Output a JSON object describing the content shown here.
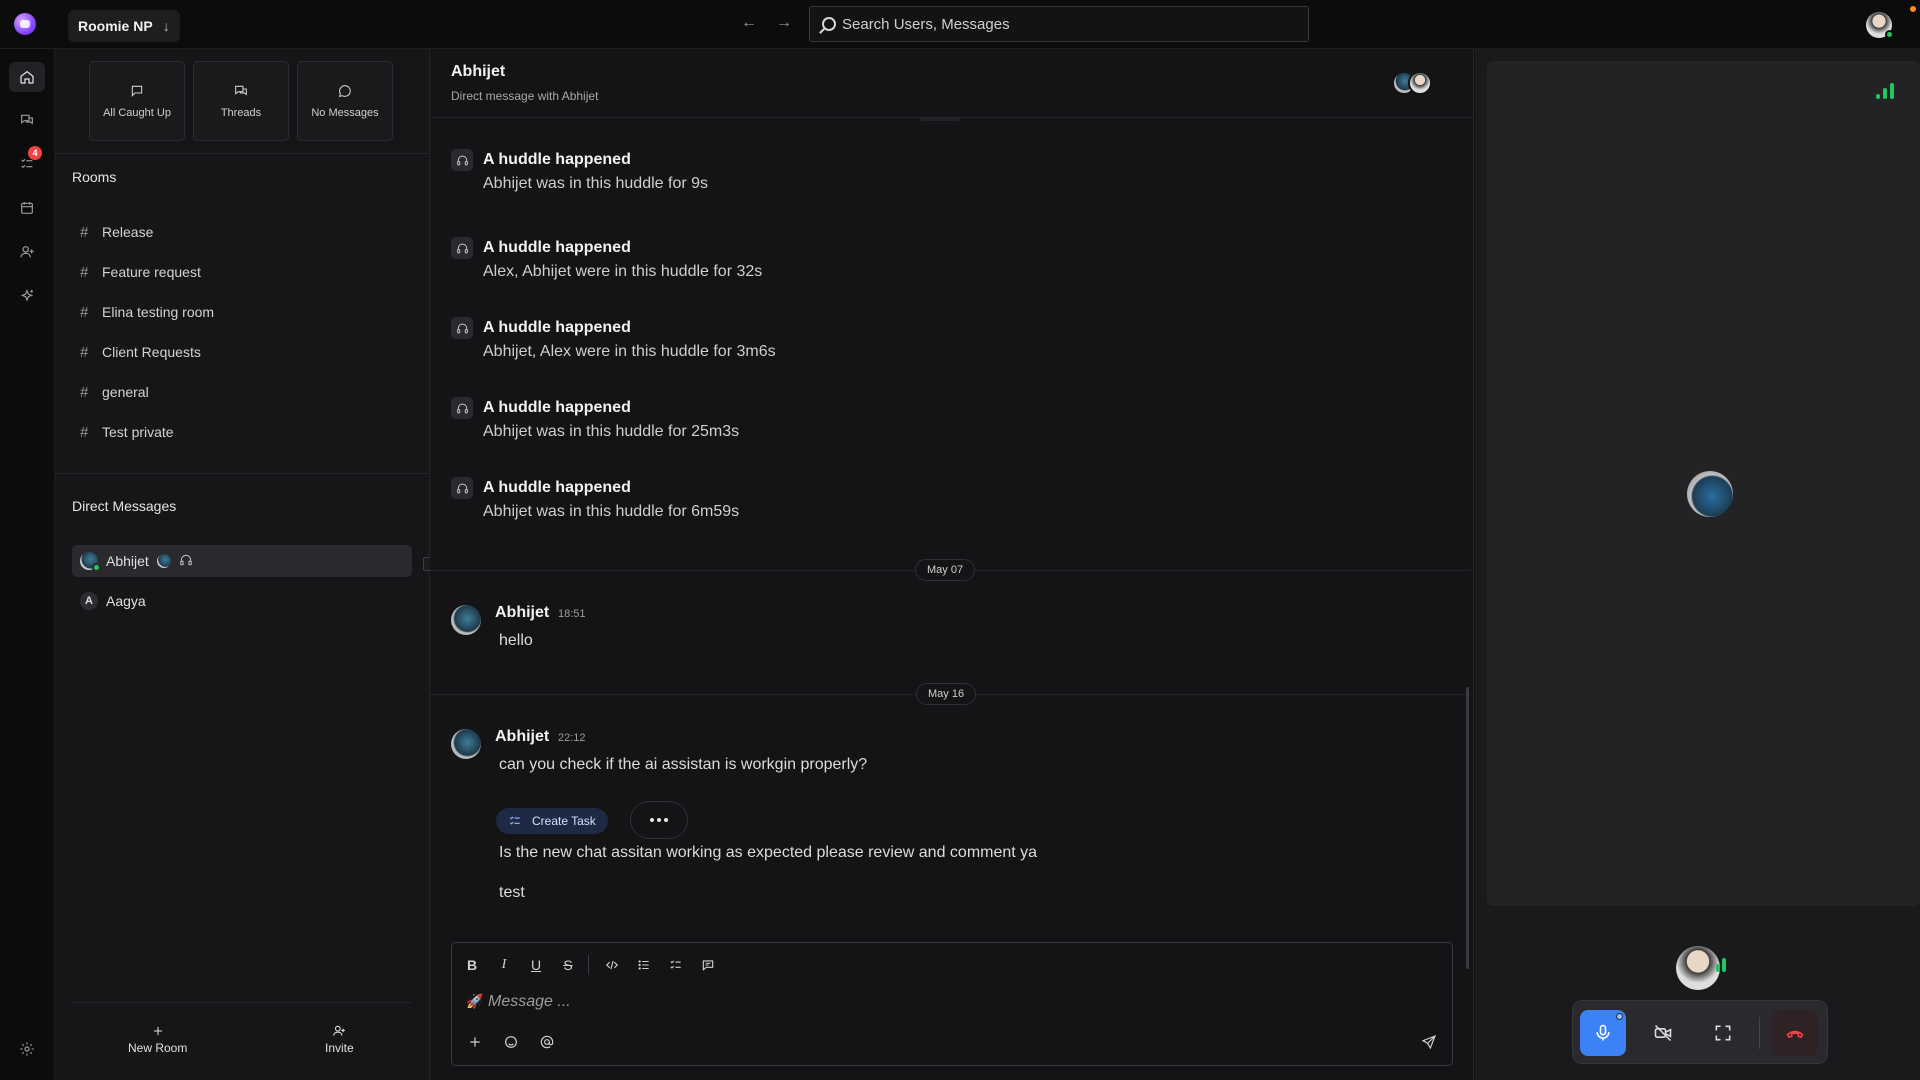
{
  "topbar": {
    "workspace_name": "Roomie NP",
    "workspace_arrow": "↓",
    "back_arrow": "←",
    "forward_arrow": "→",
    "search_placeholder": "Search Users, Messages"
  },
  "rail": {
    "items": [
      "home-icon",
      "chat-icon",
      "tasks-icon",
      "calendar-icon",
      "user-add-icon",
      "sparkles-icon",
      "settings-icon"
    ],
    "tasks_badge": "4"
  },
  "sidebar": {
    "quick": [
      {
        "label": "All Caught Up",
        "icon": "chat-bubble-icon"
      },
      {
        "label": "Threads",
        "icon": "threads-icon"
      },
      {
        "label": "No Messages",
        "icon": "message-circle-icon"
      }
    ],
    "rooms_title": "Rooms",
    "rooms": [
      "Release",
      "Feature request",
      "Elina testing room",
      "Client Requests",
      "general",
      "Test private"
    ],
    "dm_title": "Direct Messages",
    "dms": [
      {
        "name": "Abhijet",
        "avatar": "image",
        "active": true
      },
      {
        "name": "Aagya",
        "avatar_letter": "A",
        "active": false
      }
    ],
    "new_room_label": "New Room",
    "invite_label": "Invite"
  },
  "chat": {
    "title": "Abhijet",
    "subtitle": "Direct message with Abhijet",
    "huddles": [
      {
        "title": "A huddle happened",
        "detail": "Abhijet was in this huddle for 9s"
      },
      {
        "title": "A huddle happened",
        "detail": "Alex, Abhijet were in this huddle for 32s"
      },
      {
        "title": "A huddle happened",
        "detail": "Abhijet, Alex were in this huddle for 3m6s"
      },
      {
        "title": "A huddle happened",
        "detail": "Abhijet was in this huddle for 25m3s"
      },
      {
        "title": "A huddle happened",
        "detail": "Abhijet was in this huddle for 6m59s"
      }
    ],
    "date1": "May 07",
    "msg1": {
      "author": "Abhijet",
      "time": "18:51",
      "text": "hello"
    },
    "date2": "May 16",
    "msg2": {
      "author": "Abhijet",
      "time": "22:12",
      "lines": [
        "can you check if the ai assistan is workgin properly?",
        "Is the new chat assitan working as expected please review and comment ya",
        "test"
      ]
    },
    "create_task_label": "Create Task",
    "composer_placeholder": "Message ...",
    "composer_emoji": "🚀",
    "format_bold": "B",
    "format_italic": "I",
    "format_underline": "U",
    "format_strike": "S"
  },
  "call": {
    "accent": "#3b82f6",
    "leave_color": "#ef4444",
    "signal_color": "#22c55e"
  }
}
